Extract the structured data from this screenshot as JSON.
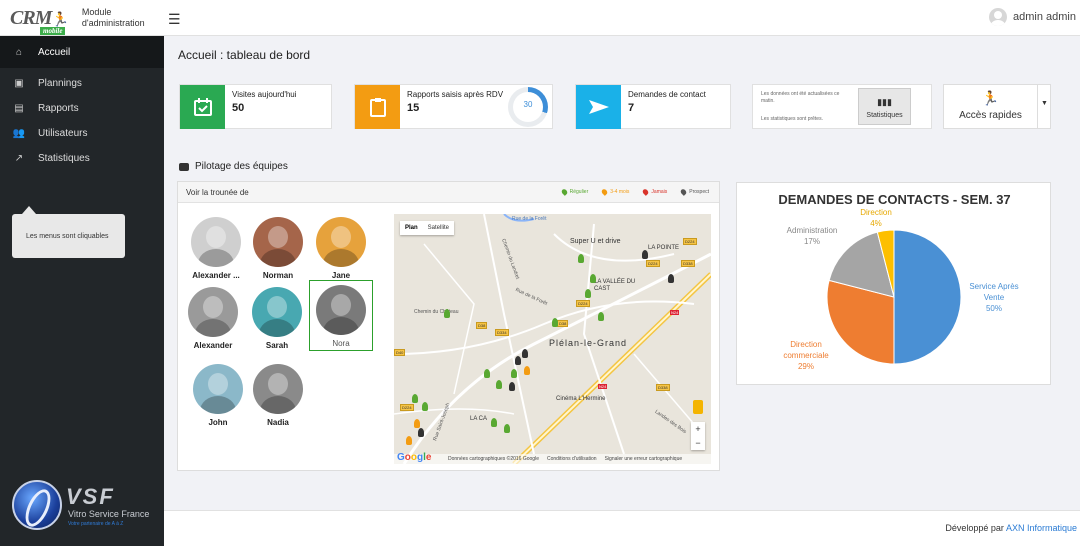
{
  "app": {
    "logo_text": "CRM",
    "logo_badge": "mobile",
    "module_line1": "Module",
    "module_line2": "d'administration",
    "user_name": "admin admin"
  },
  "sidebar": {
    "items": [
      {
        "label": "Accueil",
        "icon": "home-icon"
      },
      {
        "label": "Plannings",
        "icon": "calendar-icon"
      },
      {
        "label": "Rapports",
        "icon": "clipboard-icon"
      },
      {
        "label": "Utilisateurs",
        "icon": "users-icon"
      },
      {
        "label": "Statistiques",
        "icon": "line-chart-icon"
      }
    ],
    "tooltip": "Les menus sont cliquables",
    "brand_title": "VSF",
    "brand_subtitle": "Vitro Service France",
    "brand_tagline": "Votre partenaire de A à Z"
  },
  "main": {
    "page_title": "Accueil : tableau de bord",
    "cards": [
      {
        "label": "Visites aujourd'hui",
        "value": "50",
        "color": "#2aa952",
        "icon": "calendar-check-icon"
      },
      {
        "label": "Rapports saisis après RDV",
        "value": "15",
        "color": "#f39c12",
        "icon": "clipboard-icon",
        "progress_value": "30",
        "progress_fraction": 0.3
      },
      {
        "label": "Demandes de contact",
        "value": "7",
        "color": "#1ab1e8",
        "icon": "paper-plane-icon"
      }
    ],
    "info": {
      "text1": "Les données ont été actualisées ce matin.",
      "text2": "Les statistiques sont prêtes.",
      "button": "Statistiques"
    },
    "quick_access": "Accès rapides",
    "section_title": "Pilotage des équipes",
    "panel_title": "Voir la trounée de",
    "legend": [
      {
        "label": "Régulier",
        "color": "#59a832"
      },
      {
        "label": "3-4 mois",
        "color": "#f39c12"
      },
      {
        "label": "Jamais",
        "color": "#d9342b"
      },
      {
        "label": "Prospect",
        "color": "#555555"
      }
    ],
    "people": [
      {
        "name": "Alexander ...",
        "color": "#b9b9b9"
      },
      {
        "name": "Norman",
        "color": "#a5654a"
      },
      {
        "name": "Jane",
        "color": "#e6a23c"
      },
      {
        "name": "Alexander",
        "color": "#9a9a9a"
      },
      {
        "name": "Sarah",
        "color": "#48a8b1"
      },
      {
        "name": "Nora",
        "color": "#7a7a7a"
      },
      {
        "name": "John",
        "color": "#8bb8c9"
      },
      {
        "name": "Nadia",
        "color": "#8a8a8a"
      }
    ],
    "map": {
      "tab_plan": "Plan",
      "tab_satellite": "Satellite",
      "places": [
        "Super U et drive",
        "LA POINTE",
        "LA VALLÉE DU CAST",
        "Plélan-le-Grand",
        "Cinéma L'Hermine",
        "LA CA"
      ],
      "roads": [
        "Rue de la Forêt",
        "Chemin du Château",
        "Rue Saint-Joseph",
        "Rue de la Forêt",
        "Landes des Bois",
        "Chemin du Landret"
      ],
      "badges": [
        "D224",
        "D224",
        "D338",
        "D224",
        "D38",
        "D334",
        "D38",
        "D338",
        "D224",
        "D40"
      ],
      "red_badges": [
        "N24",
        "N24"
      ],
      "footer": [
        "Données cartographiques ©2016 Google",
        "Conditions d'utilisation",
        "Signaler une erreur cartographique"
      ],
      "zoom_in": "+",
      "zoom_out": "−"
    }
  },
  "chart_data": {
    "type": "pie",
    "title": "DEMANDES DE CONTACTS - SEM. 37",
    "slices": [
      {
        "label": "Service Après Vente",
        "pct": "50%",
        "value": 50,
        "color": "#4a90d4"
      },
      {
        "label": "Direction commerciale",
        "pct": "29%",
        "value": 29,
        "color": "#ee7d31"
      },
      {
        "label": "Administration",
        "pct": "17%",
        "value": 17,
        "color": "#a5a5a5"
      },
      {
        "label": "Direction",
        "pct": "4%",
        "value": 4,
        "color": "#fdbf00"
      }
    ]
  },
  "footer": {
    "prefix": "Développé par",
    "link": "AXN Informatique"
  }
}
